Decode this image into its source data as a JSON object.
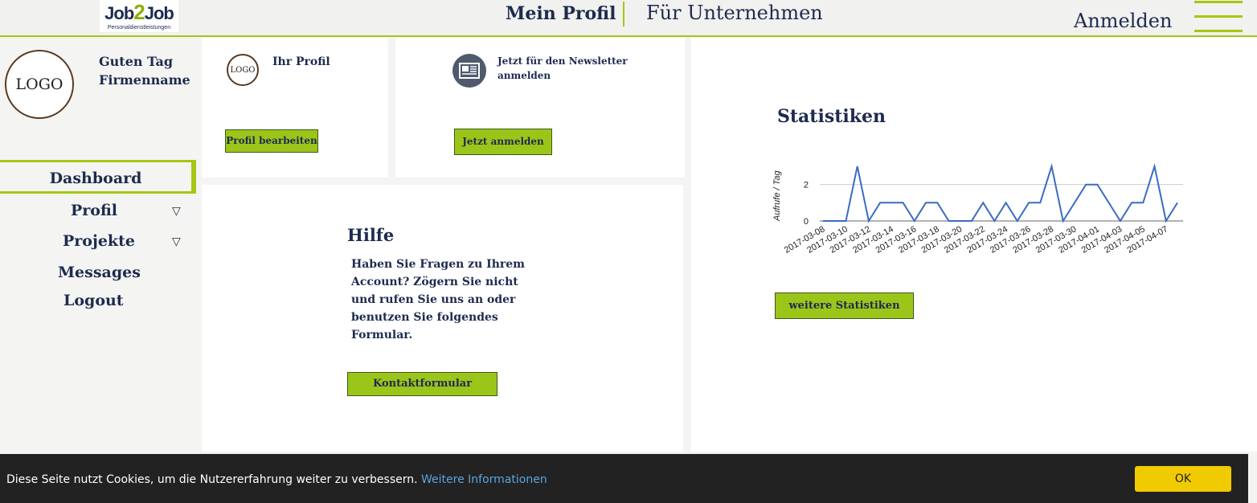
{
  "header": {
    "brand_main": "Job",
    "brand_two": "2",
    "brand_job": "Job",
    "brand_sub": "Personaldienstleistungen",
    "nav_profile": "Mein Profil",
    "nav_companies": "Für Unternehmen",
    "nav_login": "Anmelden",
    "accent_color": "#a5c712"
  },
  "sidebar": {
    "avatar_text": "LOGO",
    "greeting_line1": "Guten Tag",
    "greeting_line2": "Firmenname",
    "items": [
      {
        "label": "Dashboard",
        "active": true
      },
      {
        "label": "Profil",
        "icon": "triangle-down-icon"
      },
      {
        "label": "Projekte",
        "icon": "triangle-down-icon"
      },
      {
        "label": "Messages"
      },
      {
        "label": "Logout"
      }
    ]
  },
  "profile_card": {
    "logo_text": "LOGO",
    "title": "Ihr Profil",
    "button": "Profil bearbeiten"
  },
  "newsletter_card": {
    "icon": "newspaper-icon",
    "title": "Jetzt für den Newsletter anmelden",
    "button": "Jetzt anmelden"
  },
  "help_card": {
    "title": "Hilfe",
    "text": "Haben Sie Fragen zu Ihrem Account? Zögern Sie nicht und rufen Sie uns an oder benutzen Sie folgendes Formular.",
    "button": "Kontaktformular"
  },
  "stats_card": {
    "title": "Statistiken",
    "button": "weitere Statistiken"
  },
  "chart_data": {
    "type": "line",
    "ylabel": "Aufrufe / Tag",
    "ylim": [
      0,
      3
    ],
    "yticks": [
      0,
      2
    ],
    "x": [
      "2017-03-08",
      "2017-03-09",
      "2017-03-10",
      "2017-03-11",
      "2017-03-12",
      "2017-03-13",
      "2017-03-14",
      "2017-03-15",
      "2017-03-16",
      "2017-03-17",
      "2017-03-18",
      "2017-03-19",
      "2017-03-20",
      "2017-03-21",
      "2017-03-22",
      "2017-03-23",
      "2017-03-24",
      "2017-03-25",
      "2017-03-26",
      "2017-03-27",
      "2017-03-28",
      "2017-03-29",
      "2017-03-30",
      "2017-03-31",
      "2017-04-01",
      "2017-04-02",
      "2017-04-03",
      "2017-04-04",
      "2017-04-05",
      "2017-04-06",
      "2017-04-07",
      "2017-04-08"
    ],
    "xticks": [
      "2017-03-08",
      "2017-03-10",
      "2017-03-12",
      "2017-03-14",
      "2017-03-16",
      "2017-03-18",
      "2017-03-20",
      "2017-03-22",
      "2017-03-24",
      "2017-03-26",
      "2017-03-28",
      "2017-03-30",
      "2017-04-01",
      "2017-04-03",
      "2017-04-05",
      "2017-04-07"
    ],
    "series": [
      {
        "values": [
          0,
          0,
          0,
          3,
          0,
          1,
          1,
          1,
          0,
          1,
          1,
          0,
          0,
          0,
          1,
          0,
          1,
          0,
          1,
          1,
          3,
          0,
          1,
          2,
          2,
          1,
          0,
          1,
          1,
          3,
          0,
          1
        ],
        "color": "#3a6cc4"
      }
    ],
    "grid": true
  },
  "cookie": {
    "text": "Diese Seite nutzt Cookies, um die Nutzererfahrung weiter zu verbessern. ",
    "link": "Weitere Informationen",
    "ok": "OK"
  }
}
